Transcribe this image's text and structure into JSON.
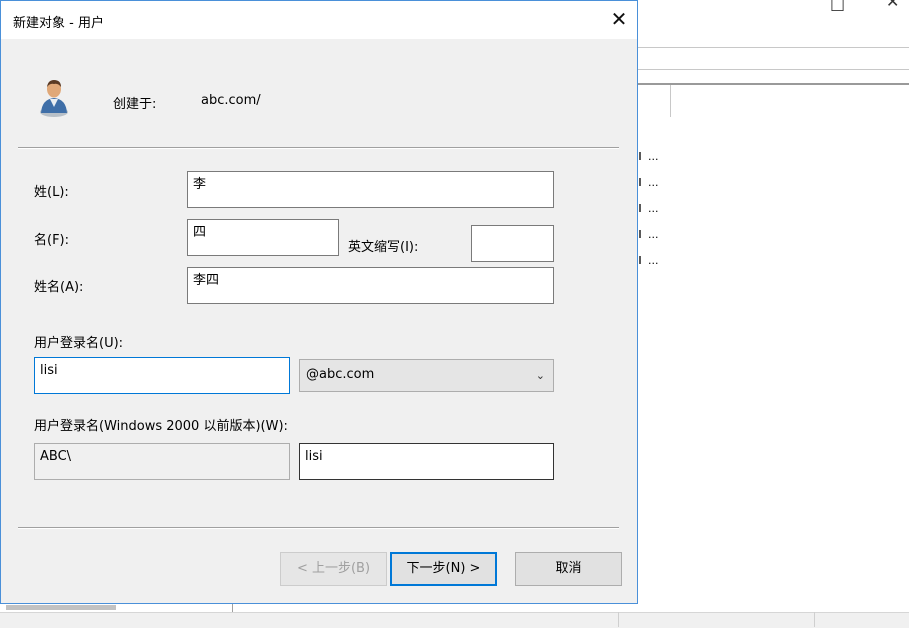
{
  "background_window": {
    "minimize_glyph": "□",
    "close_glyph": "✕",
    "tree_items": [
      "...",
      "...",
      "...",
      "...",
      "..."
    ]
  },
  "dialog": {
    "title": "新建对象 - 用户",
    "close_glyph": "✕",
    "created_in_label": "创建于:",
    "created_in_value": "abc.com/",
    "last_name": {
      "label": "姓(L):",
      "value": "李"
    },
    "first_name": {
      "label": "名(F):",
      "value": "四"
    },
    "initials": {
      "label": "英文缩写(I):",
      "value": ""
    },
    "full_name": {
      "label": "姓名(A):",
      "value": "李四"
    },
    "logon_name": {
      "label": "用户登录名(U):",
      "value": "lisi",
      "domain": "@abc.com"
    },
    "pre2000_logon": {
      "label": "用户登录名(Windows 2000 以前版本)(W):",
      "domain_prefix": "ABC\\",
      "value": "lisi"
    },
    "buttons": {
      "back": "< 上一步(B)",
      "next": "下一步(N) >",
      "cancel": "取消"
    }
  }
}
